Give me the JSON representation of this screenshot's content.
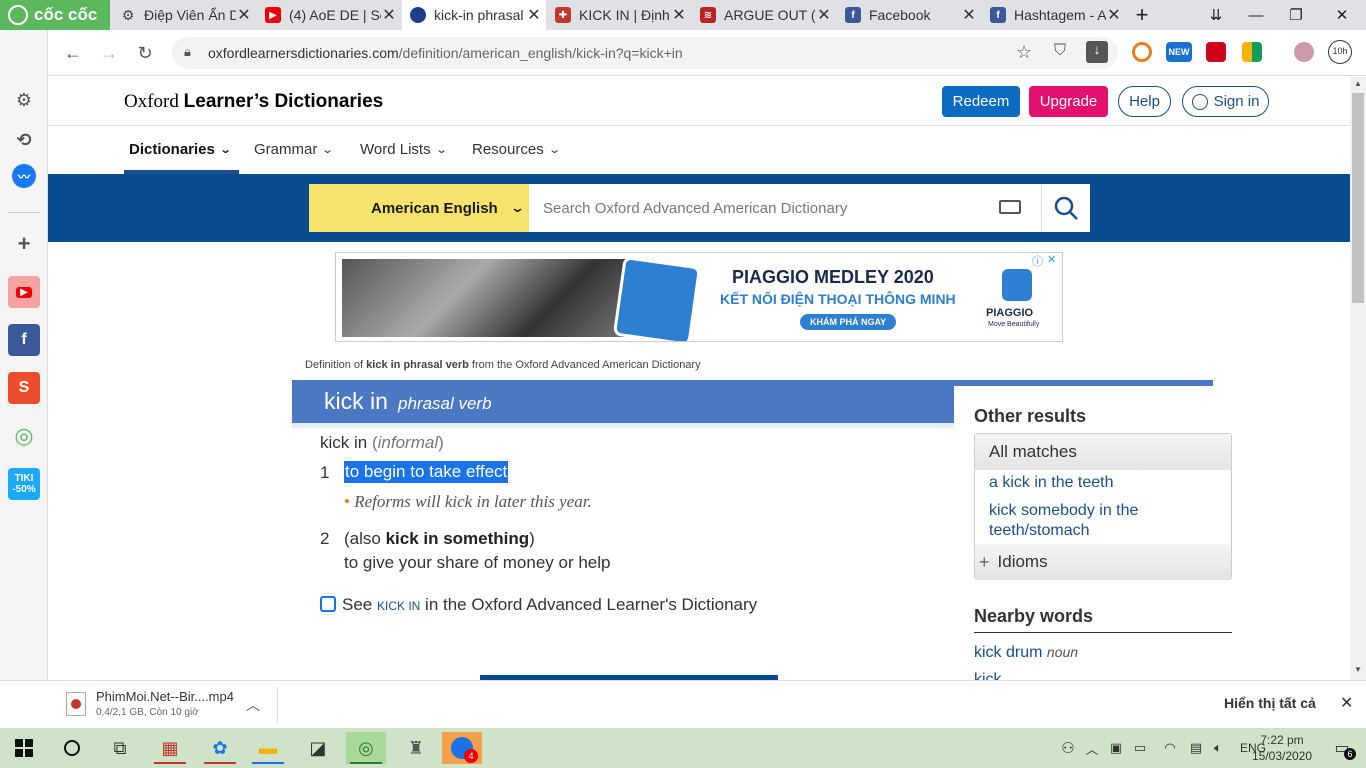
{
  "browser": {
    "brand": "cốc cốc",
    "tabs": [
      {
        "title": "Điệp Viên Ẩn D",
        "icon": "gear-icon"
      },
      {
        "title": "(4) AoE DE | So",
        "icon": "youtube-icon"
      },
      {
        "title": "kick-in phrasal",
        "icon": "oxford-icon"
      },
      {
        "title": "KICK IN | Định",
        "icon": "cambridge-icon"
      },
      {
        "title": "ARGUE OUT (p",
        "icon": "dictionary-icon"
      },
      {
        "title": "Facebook",
        "icon": "facebook-icon"
      },
      {
        "title": "Hashtagem - A",
        "icon": "facebook-icon"
      }
    ],
    "url_host": "oxfordlearnersdictionaries.com",
    "url_path": "/definition/american_english/kick-in?q=kick+in",
    "ext_badge_new": "NEW",
    "ext_timer": "10h"
  },
  "site": {
    "logo_light": "Oxford ",
    "logo_bold": "Learner’s Dictionaries",
    "redeem": "Redeem",
    "upgrade": "Upgrade",
    "help": "Help",
    "signin": "Sign in",
    "nav": [
      "Dictionaries",
      "Grammar",
      "Word Lists",
      "Resources"
    ],
    "lang": "American English",
    "search_placeholder": "Search Oxford Advanced American Dictionary"
  },
  "ad": {
    "title": "PIAGGIO MEDLEY 2020",
    "subtitle": "KẾT NỐI ĐIỆN THOẠI THÔNG MINH",
    "cta": "KHÁM PHÁ NGAY",
    "brand": "PIAGGIO",
    "brand_tag": "Move Beautifully"
  },
  "entry": {
    "source_pre": "Definition of ",
    "source_bold": "kick in phrasal verb",
    "source_post": " from the Oxford Advanced American Dictionary",
    "word": "kick in",
    "pos": "phrasal verb",
    "label_word": "kick in",
    "label_register": "informal",
    "senses": [
      {
        "num": "1",
        "def": "to begin to take effect",
        "example": "Reforms will kick in later this year."
      },
      {
        "num": "2",
        "also_pre": "(also ",
        "also_bold": "kick in something",
        "also_post": ")",
        "def": "to give your share of money or help"
      }
    ],
    "see_pre": "See ",
    "see_link": "KICK IN",
    "see_post": " in the Oxford Advanced Learner's Dictionary"
  },
  "sidebar_right": {
    "other_results": "Other results",
    "all_matches": "All matches",
    "matches": [
      "a kick in the teeth",
      "kick somebody in the teeth/stomach"
    ],
    "idioms": "Idioms",
    "nearby_title": "Nearby words",
    "nearby": [
      {
        "word": "kick drum",
        "pos": "noun"
      },
      {
        "word": "kick",
        "pos": ""
      }
    ]
  },
  "downloads": {
    "file": "PhimMoi.Net--Bir....mp4",
    "status": "0,4/2,1 GB, Còn 10 giờ",
    "show_all": "Hiển thị tất cả"
  },
  "taskbar": {
    "lang": "ENG",
    "time": "7:22 pm",
    "date": "15/03/2020",
    "zalo_badge": "4",
    "notif": "6"
  },
  "colors": {
    "oxford_blue": "#0a4a8e",
    "heading_blue": "#4a78c2",
    "upgrade_pink": "#e3106d",
    "lang_yellow": "#f5e36e",
    "coccoc_green": "#5cb85c"
  }
}
